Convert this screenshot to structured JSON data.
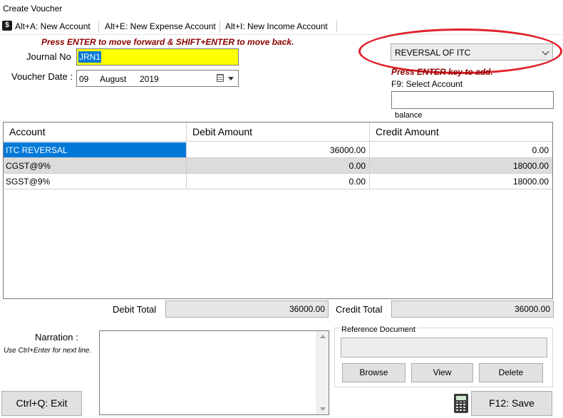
{
  "window": {
    "title": "Create Voucher"
  },
  "toolbar": {
    "items": [
      {
        "label": "Alt+A: New Account"
      },
      {
        "label": "Alt+E: New Expense Account"
      },
      {
        "label": "Alt+I: New Income Account"
      }
    ]
  },
  "hints": {
    "navigation": "Press ENTER to move forward & SHIFT+ENTER to move back.",
    "press_enter": "Press ENTER key to add.",
    "f9": "F9: Select Account",
    "balance": "balance"
  },
  "form": {
    "journal_label": "Journal No",
    "journal_value": "JRN1",
    "date_label": "Voucher Date :",
    "date_day": "09",
    "date_month": "August",
    "date_year": "2019",
    "voucher_type": "REVERSAL OF ITC",
    "account_search": ""
  },
  "grid": {
    "columns": [
      "Account",
      "Debit Amount",
      "Credit Amount"
    ],
    "rows": [
      {
        "account": "ITC REVERSAL",
        "debit": "36000.00",
        "credit": "0.00"
      },
      {
        "account": "CGST@9%",
        "debit": "0.00",
        "credit": "18000.00"
      },
      {
        "account": "SGST@9%",
        "debit": "0.00",
        "credit": "18000.00"
      }
    ]
  },
  "totals": {
    "debit_label": "Debit Total",
    "debit_value": "36000.00",
    "credit_label": "Credit Total",
    "credit_value": "36000.00"
  },
  "narration": {
    "label": "Narration :",
    "hint": "Use Ctrl+Enter for next line.",
    "value": ""
  },
  "reference": {
    "title": "Reference Document",
    "value": "",
    "browse_label": "Browse",
    "view_label": "View",
    "delete_label": "Delete"
  },
  "actions": {
    "exit_label": "Ctrl+Q: Exit",
    "save_label": "F12: Save"
  },
  "colors": {
    "journal_bg": "#ffff00",
    "selection": "#0078d7",
    "hint_text": "#8b0000",
    "annotation_ellipse": "#e0202a"
  },
  "icons": [
    "dollar-icon",
    "calendar-icon",
    "chevron-down-icon",
    "calculator-icon"
  ]
}
